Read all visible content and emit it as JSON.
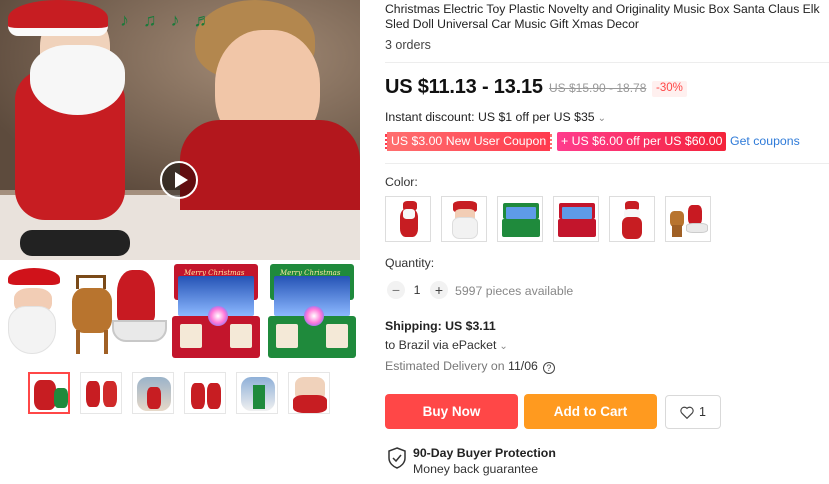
{
  "product": {
    "title": "Christmas Electric Toy Plastic Novelty and Originality Music Box Santa Claus Elk Sled Doll Universal Car Music Gift Xmas Decor",
    "orders": "3 orders"
  },
  "price": {
    "current": "US $11.13 - 13.15",
    "original": "US $15.90 - 18.78",
    "discount": "-30%"
  },
  "promo": {
    "instant": "Instant discount: US $1 off per US $35",
    "coupon_new_user": "US $3.00 New User Coupon",
    "coupon_store": "US $6.00 off per US $60.00",
    "get_coupons": "Get coupons"
  },
  "color": {
    "label": "Color:",
    "options": [
      "santa-standing",
      "santa-face",
      "music-box-green",
      "music-box-red",
      "santa-dancing",
      "santa-elk-sled"
    ],
    "selected": null
  },
  "quantity": {
    "label": "Quantity:",
    "minus": "−",
    "plus": "+",
    "value": "1",
    "available": "5997 pieces available"
  },
  "shipping": {
    "label": "Shipping: US $3.11",
    "destination": "to Brazil via ePacket",
    "delivery_prefix": "Estimated Delivery on",
    "delivery_date": "11/06"
  },
  "actions": {
    "buy_now": "Buy Now",
    "add_to_cart": "Add to Cart",
    "wishlist_count": "1"
  },
  "protection": {
    "title": "90-Day Buyer Protection",
    "subtitle": "Money back guarantee"
  },
  "gallery": {
    "notes": "♪♫♪♬",
    "box_title": "Merry Christmas",
    "thumb_count": 6
  },
  "colors": {
    "accent_red": "#ff4747",
    "accent_orange": "#ff9a1f",
    "link_blue": "#2e7ad8"
  }
}
